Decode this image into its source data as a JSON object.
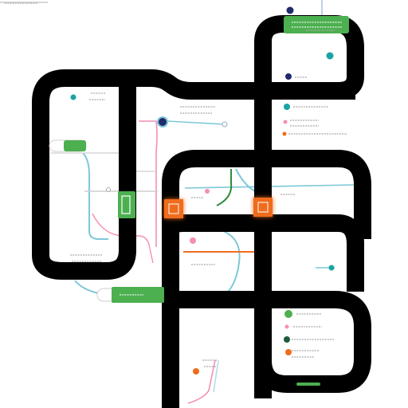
{
  "diagram": {
    "title": "",
    "colors": {
      "track": "#000000",
      "background": "#ffffff",
      "green": "#4caf50",
      "green_dark": "#2e8b3a",
      "teal": "#7ec8d8",
      "pink": "#f48fb1",
      "orange": "#ef6c1e",
      "navy": "#1f2a6b",
      "teal_dot": "#1ba3a3",
      "gray_text": "#9a9a9a"
    },
    "labels": [
      {
        "name": "label-top-left",
        "text": ""
      },
      {
        "name": "label-green-top",
        "text": ""
      },
      {
        "name": "label-top-right",
        "text": ""
      },
      {
        "name": "label-legend-1",
        "text": ""
      },
      {
        "name": "label-legend-2",
        "text": ""
      },
      {
        "name": "label-legend-3",
        "text": ""
      },
      {
        "name": "label-center",
        "text": ""
      },
      {
        "name": "label-left-1",
        "text": ""
      },
      {
        "name": "label-left-bottom",
        "text": ""
      },
      {
        "name": "label-mid-1",
        "text": ""
      },
      {
        "name": "label-green-bottom",
        "text": ""
      },
      {
        "name": "label-right-mid",
        "text": ""
      },
      {
        "name": "label-right-1",
        "text": ""
      },
      {
        "name": "label-right-2",
        "text": ""
      },
      {
        "name": "label-right-3",
        "text": ""
      },
      {
        "name": "label-bottom-mid",
        "text": ""
      }
    ],
    "icons": [
      "station-navy-icon",
      "station-teal-icon",
      "station-pink-icon",
      "station-orange-icon",
      "station-green-icon",
      "station-darkgreen-icon",
      "interchange-glow-icon"
    ]
  }
}
